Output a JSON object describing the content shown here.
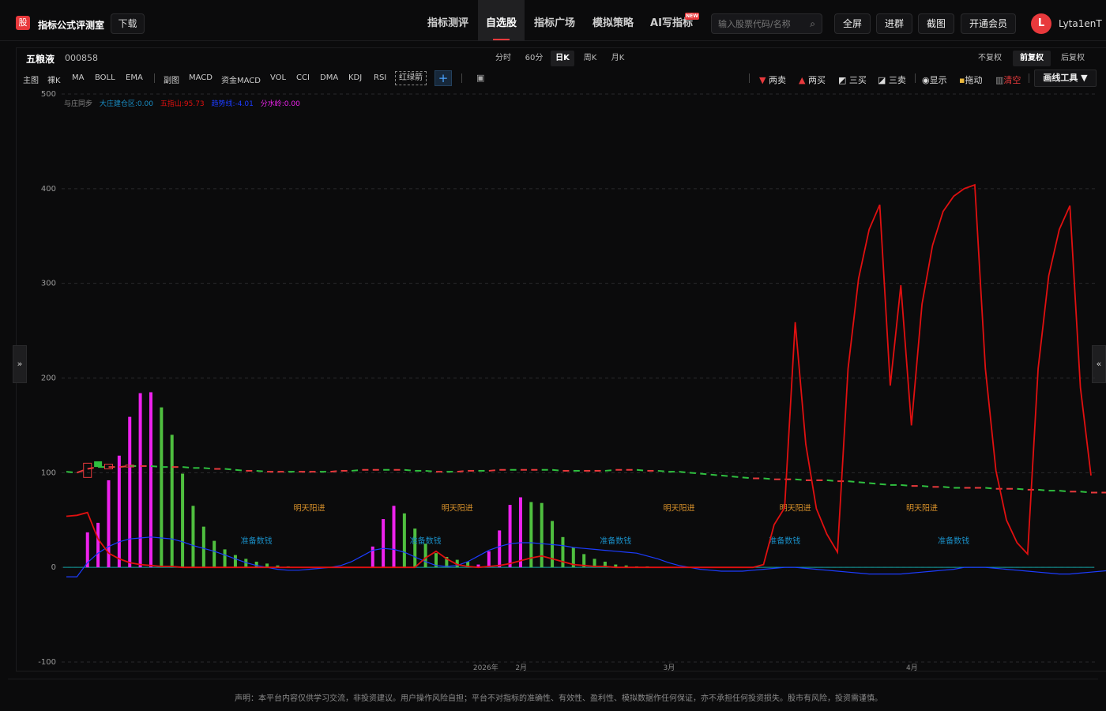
{
  "header": {
    "logo_char": "股",
    "brand": "指标公式评测室",
    "download": "下载",
    "nav": [
      {
        "label": "指标测评",
        "active": false
      },
      {
        "label": "自选股",
        "active": true
      },
      {
        "label": "指标广场",
        "active": false
      },
      {
        "label": "模拟策略",
        "active": false
      },
      {
        "label": "AI写指标",
        "active": false
      }
    ],
    "new_badge": "NEW",
    "search_placeholder": "输入股票代码/名称",
    "buttons": [
      "全屏",
      "进群",
      "截图",
      "开通会员"
    ],
    "avatar_letter": "L",
    "username": "Lyta1enT"
  },
  "stock": {
    "name": "五粮液",
    "code": "000858"
  },
  "periods": [
    {
      "label": "分时",
      "active": false
    },
    {
      "label": "60分",
      "active": false
    },
    {
      "label": "日K",
      "active": true
    },
    {
      "label": "周K",
      "active": false
    },
    {
      "label": "月K",
      "active": false
    }
  ],
  "adjust": [
    {
      "label": "不复权",
      "active": false
    },
    {
      "label": "前复权",
      "active": true
    },
    {
      "label": "后复权",
      "active": false
    }
  ],
  "indicators_main": [
    "主图",
    "裸K",
    "MA",
    "BOLL",
    "EMA"
  ],
  "indicators_sub": [
    "副图",
    "MACD",
    "资金MACD",
    "VOL",
    "CCI",
    "DMA",
    "KDJ",
    "RSI"
  ],
  "highlight_indicator": "红绿箭",
  "plus_label": "+",
  "right_tools": {
    "two_sell": "两卖",
    "two_buy": "两买",
    "three_buy": "三买",
    "three_sell": "三卖",
    "show": "显示",
    "drag": "拖动",
    "clear": "清空",
    "draw_tool": "画线工具 ▼"
  },
  "side_left": "»",
  "side_right": "«",
  "legend": {
    "sync": "与庄同步",
    "a": "大庄建仓区:0.00",
    "b": "五指山:95.73",
    "c": "趋势线:-4.01",
    "d": "分水岭:0.00"
  },
  "colors": {
    "red": "#e8393c",
    "green": "#2fbf3f",
    "magenta": "#ee22ee",
    "up_green": "#4fbf3f",
    "line_red": "#e01010",
    "blue": "#1c3cff",
    "annotation_orange": "#d7902a",
    "annotation_blue": "#1a8fc7"
  },
  "chart_data": {
    "type": "line",
    "ylim": [
      -100,
      500
    ],
    "yticks": [
      500,
      400,
      300,
      200,
      100,
      0,
      -100
    ],
    "xlabels": [
      "2026年",
      "2月",
      "3月",
      "4月"
    ],
    "annotations": {
      "bull": "明天阳进",
      "prep": "准备数钱"
    },
    "bull_labels_x_index": [
      23,
      37,
      58,
      69,
      81
    ],
    "prep_labels_x_index": [
      18,
      34,
      52,
      68,
      84
    ],
    "histogram": [
      0,
      0,
      37,
      47,
      92,
      118,
      159,
      184,
      185,
      169,
      140,
      99,
      65,
      43,
      28,
      19,
      13,
      9,
      6,
      4,
      2,
      1,
      0,
      0,
      0,
      0,
      0,
      0,
      0,
      22,
      51,
      65,
      57,
      41,
      25,
      15,
      11,
      8,
      6,
      3,
      17,
      39,
      66,
      74,
      69,
      68,
      49,
      32,
      21,
      14,
      9,
      6,
      3,
      2,
      1,
      1,
      0,
      0,
      0,
      0,
      0,
      0,
      0,
      0,
      0,
      0,
      0,
      0,
      0,
      0,
      0,
      0,
      0,
      0,
      0,
      0,
      0,
      0,
      0,
      0,
      0,
      0,
      0,
      0,
      0,
      0,
      0,
      0,
      0,
      0,
      0,
      0,
      0,
      0,
      0,
      0,
      0,
      0,
      0,
      0,
      0,
      0,
      0,
      0
    ],
    "histogram_color": [
      "m",
      "m",
      "m",
      "m",
      "m",
      "m",
      "m",
      "m",
      "m",
      "g",
      "g",
      "g",
      "g",
      "g",
      "g",
      "g",
      "g",
      "g",
      "g",
      "g",
      "g",
      "g",
      "g",
      "g",
      "g",
      "g",
      "g",
      "g",
      "g",
      "m",
      "m",
      "m",
      "g",
      "g",
      "g",
      "g",
      "g",
      "g",
      "g",
      "m",
      "m",
      "m",
      "m",
      "m",
      "g",
      "g",
      "g",
      "g",
      "g",
      "g",
      "g",
      "g",
      "g",
      "g",
      "g",
      "g",
      "g",
      "g",
      "g",
      "g",
      "g",
      "g",
      "g",
      "g",
      "g",
      "g",
      "g",
      "g",
      "g",
      "g",
      "g",
      "g",
      "g",
      "g",
      "g",
      "g",
      "g",
      "g",
      "g",
      "g",
      "g",
      "g",
      "g",
      "g",
      "g",
      "g",
      "g",
      "g",
      "g",
      "g",
      "g",
      "g",
      "g",
      "g",
      "g",
      "g",
      "g",
      "g",
      "g",
      "g",
      "g",
      "g",
      "g",
      "g"
    ],
    "series": [
      {
        "name": "五指山",
        "values": [
          54,
          55,
          58,
          30,
          15,
          9,
          5,
          3,
          2,
          1,
          1,
          0,
          0,
          0,
          0,
          0,
          0,
          0,
          0,
          0,
          0,
          0,
          0,
          0,
          0,
          0,
          0,
          0,
          0,
          0,
          0,
          0,
          0,
          0,
          10,
          17,
          9,
          3,
          1,
          0,
          1,
          2,
          4,
          7,
          10,
          12,
          9,
          6,
          3,
          2,
          1,
          1,
          0,
          0,
          0,
          0,
          0,
          0,
          0,
          0,
          0,
          0,
          0,
          0,
          0,
          0,
          3,
          45,
          63,
          259,
          130,
          62,
          35,
          16,
          210,
          305,
          357,
          383,
          192,
          298,
          150,
          278,
          340,
          376,
          392,
          400,
          404,
          210,
          102,
          50,
          26,
          14,
          210,
          308,
          357,
          382,
          190,
          97
        ]
      },
      {
        "name": "趋势线",
        "values": [
          -10,
          -10,
          5,
          15,
          22,
          27,
          30,
          31,
          32,
          31,
          30,
          27,
          23,
          20,
          17,
          13,
          9,
          5,
          2,
          0,
          -2,
          -3,
          -3,
          -2,
          -1,
          0,
          2,
          6,
          12,
          18,
          20,
          19,
          16,
          11,
          6,
          2,
          1,
          2,
          6,
          12,
          18,
          22,
          25,
          26,
          26,
          25,
          24,
          23,
          21,
          20,
          19,
          18,
          17,
          16,
          15,
          12,
          9,
          5,
          2,
          0,
          -2,
          -3,
          -4,
          -4,
          -4,
          -3,
          -2,
          -1,
          0,
          0,
          -1,
          -2,
          -3,
          -4,
          -5,
          -6,
          -7,
          -7,
          -7,
          -7,
          -6,
          -5,
          -4,
          -3,
          -2,
          0,
          0,
          0,
          -1,
          -2,
          -3,
          -4,
          -5,
          -6,
          -7,
          -7,
          -6,
          -5,
          -4,
          -3,
          -2,
          -1,
          0,
          0
        ]
      },
      {
        "name": "大庄建仓区",
        "values": [
          0,
          0,
          0,
          0,
          0,
          0,
          0,
          0,
          0,
          0,
          0,
          0,
          0,
          0,
          0,
          0,
          0,
          0,
          0,
          0,
          0,
          0,
          0,
          0,
          0,
          0,
          0,
          0,
          0,
          0,
          0,
          0,
          0,
          0,
          0,
          0,
          0,
          0,
          0,
          0,
          0,
          0,
          0,
          0,
          0,
          0,
          0,
          0,
          0,
          0,
          0,
          0,
          0,
          0,
          0,
          0,
          0,
          0,
          0,
          0,
          0,
          0,
          0,
          0,
          0,
          0,
          0,
          0,
          0,
          0,
          0,
          0,
          0,
          0,
          0,
          0,
          0,
          0,
          0,
          0,
          0,
          0,
          0,
          0,
          0,
          0,
          0,
          0,
          0,
          0,
          0,
          0,
          0,
          0,
          0,
          0,
          0,
          0,
          0,
          0,
          0,
          0,
          0,
          0
        ]
      },
      {
        "name": "price_ma",
        "values": [
          101,
          100,
          104,
          106,
          106,
          106,
          107,
          107,
          107,
          106,
          106,
          106,
          105,
          105,
          104,
          104,
          103,
          102,
          102,
          101,
          101,
          101,
          101,
          101,
          101,
          101,
          102,
          102,
          103,
          103,
          103,
          103,
          103,
          102,
          102,
          101,
          101,
          101,
          102,
          102,
          102,
          103,
          103,
          103,
          103,
          103,
          103,
          102,
          102,
          102,
          102,
          102,
          103,
          103,
          103,
          102,
          102,
          101,
          101,
          100,
          99,
          98,
          97,
          96,
          95,
          94,
          94,
          93,
          93,
          93,
          92,
          92,
          92,
          91,
          91,
          90,
          89,
          88,
          87,
          87,
          86,
          86,
          85,
          85,
          84,
          84,
          84,
          84,
          83,
          83,
          83,
          82,
          82,
          81,
          81,
          80,
          80,
          79,
          79,
          79,
          79,
          79,
          79,
          79
        ]
      }
    ],
    "candles": [
      {
        "i": 2,
        "open": 95,
        "close": 110,
        "up": true
      },
      {
        "i": 3,
        "open": 106,
        "close": 112,
        "up": false
      },
      {
        "i": 4,
        "open": 104,
        "close": 109,
        "up": true
      },
      {
        "i": 6,
        "open": 106,
        "close": 108,
        "up": true
      }
    ]
  },
  "disclaimer": "声明：本平台内容仅供学习交流，非投资建议。用户操作风险自担；平台不对指标的准确性、有效性、盈利性、模拟数据作任何保证，亦不承担任何投资损失。股市有风险，投资需谨慎。"
}
